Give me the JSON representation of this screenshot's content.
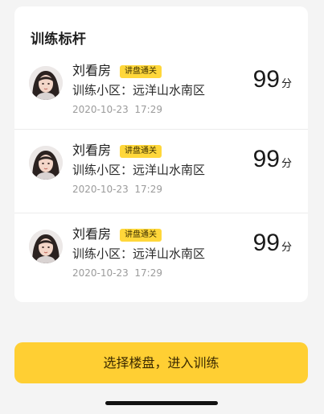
{
  "card": {
    "title": "训练标杆",
    "entries": [
      {
        "name": "刘看房",
        "badge": "讲盘通关",
        "community": "训练小区：远洋山水南区",
        "date": "2020-10-23",
        "time": "17:29",
        "score": "99",
        "unit": "分"
      },
      {
        "name": "刘看房",
        "badge": "讲盘通关",
        "community": "训练小区：远洋山水南区",
        "date": "2020-10-23",
        "time": "17:29",
        "score": "99",
        "unit": "分"
      },
      {
        "name": "刘看房",
        "badge": "讲盘通关",
        "community": "训练小区：远洋山水南区",
        "date": "2020-10-23",
        "time": "17:29",
        "score": "99",
        "unit": "分"
      }
    ]
  },
  "cta": {
    "label": "选择楼盘，进入训练"
  },
  "colors": {
    "accent": "#ffcf33",
    "badge": "#ffd73a",
    "background": "#f4f4f4"
  },
  "icons": {
    "avatar": "user-avatar-photo"
  }
}
